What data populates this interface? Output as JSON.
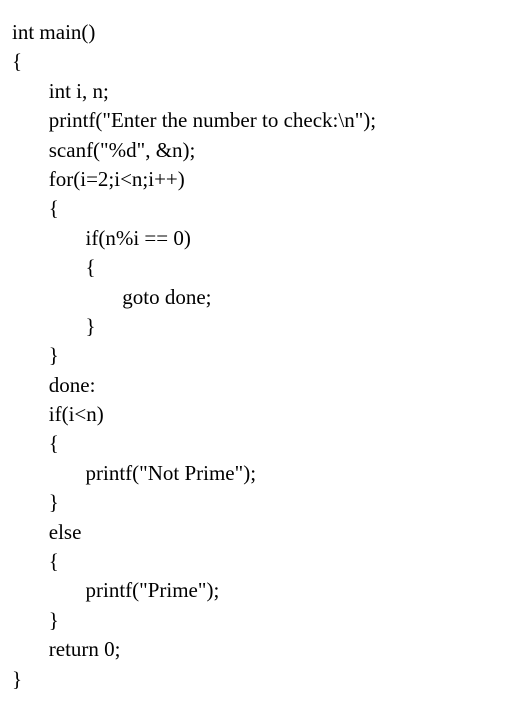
{
  "code": {
    "lines": [
      "int main()",
      "{",
      "       int i, n;",
      "       printf(\"Enter the number to check:\\n\");",
      "       scanf(\"%d\", &n);",
      "       for(i=2;i<n;i++)",
      "       {",
      "              if(n%i == 0)",
      "              {",
      "                     goto done;",
      "              }",
      "       }",
      "       done:",
      "       if(i<n)",
      "       {",
      "              printf(\"Not Prime\");",
      "       }",
      "       else",
      "       {",
      "              printf(\"Prime\");",
      "       }",
      "       return 0;",
      "}"
    ]
  }
}
